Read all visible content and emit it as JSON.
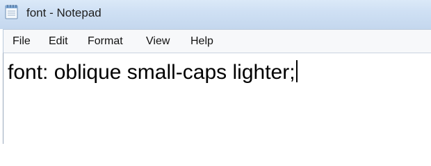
{
  "window": {
    "title": "font - Notepad",
    "icon": "notepad-icon"
  },
  "menubar": {
    "items": [
      "File",
      "Edit",
      "Format",
      "View",
      "Help"
    ]
  },
  "editor": {
    "content": "font: oblique small-caps lighter;"
  }
}
